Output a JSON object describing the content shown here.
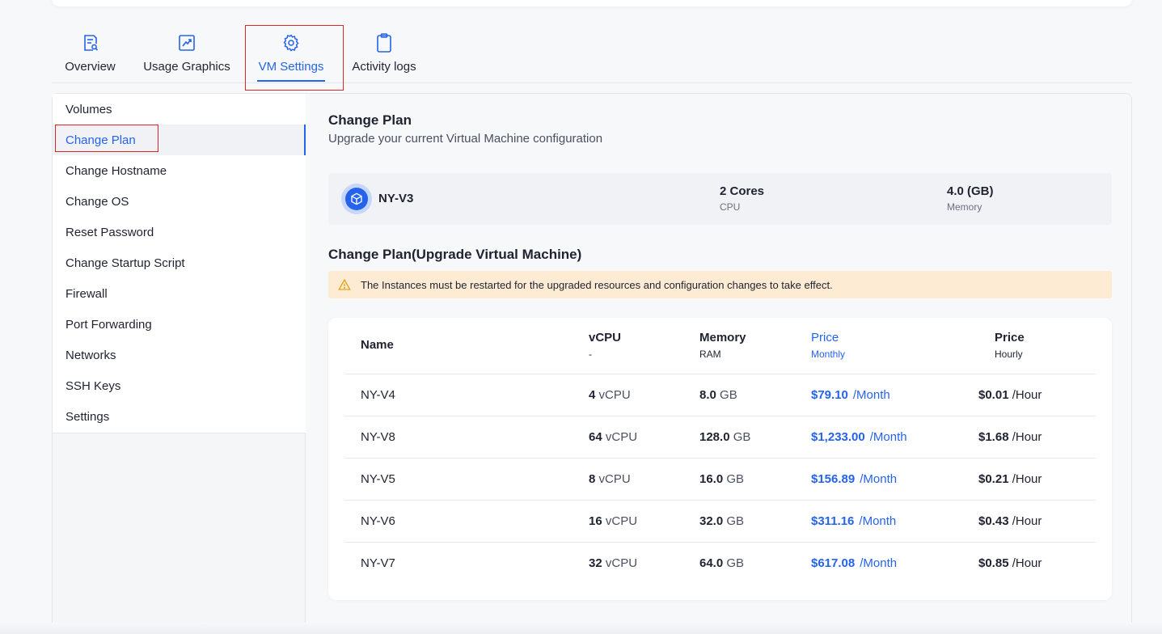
{
  "tabs": [
    {
      "label": "Overview",
      "icon": "document-search-icon"
    },
    {
      "label": "Usage Graphics",
      "icon": "line-chart-icon"
    },
    {
      "label": "VM Settings",
      "icon": "gear-icon",
      "active": true
    },
    {
      "label": "Activity logs",
      "icon": "clipboard-icon"
    }
  ],
  "sidebar": {
    "items": [
      {
        "label": "Volumes"
      },
      {
        "label": "Change Plan",
        "active": true
      },
      {
        "label": "Change Hostname"
      },
      {
        "label": "Change OS"
      },
      {
        "label": "Reset Password"
      },
      {
        "label": "Change Startup Script"
      },
      {
        "label": "Firewall"
      },
      {
        "label": "Port Forwarding"
      },
      {
        "label": "Networks"
      },
      {
        "label": "SSH Keys"
      },
      {
        "label": "Settings"
      }
    ]
  },
  "main": {
    "title": "Change Plan",
    "subtitle": "Upgrade your current Virtual Machine configuration",
    "current": {
      "name": "NY-V3",
      "cpu_value": "2 Cores",
      "cpu_label": "CPU",
      "memory_value": "4.0 (GB)",
      "memory_label": "Memory"
    },
    "section_title": "Change Plan(Upgrade Virtual Machine)",
    "alert": "The Instances must be restarted for the upgraded resources and configuration changes to take effect.",
    "table": {
      "headers": {
        "name": "Name",
        "vcpu": "vCPU",
        "vcpu_sub": "-",
        "memory": "Memory",
        "memory_sub": "RAM",
        "price_monthly": "Price",
        "price_monthly_sub": "Monthly",
        "price_hourly": "Price",
        "price_hourly_sub": "Hourly"
      },
      "units": {
        "vcpu": "vCPU",
        "memory": "GB",
        "month": "/Month",
        "hour": "/Hour"
      },
      "rows": [
        {
          "name": "NY-V4",
          "vcpu": "4",
          "memory": "8.0",
          "monthly": "$79.10",
          "hourly": "$0.01"
        },
        {
          "name": "NY-V8",
          "vcpu": "64",
          "memory": "128.0",
          "monthly": "$1,233.00",
          "hourly": "$1.68"
        },
        {
          "name": "NY-V5",
          "vcpu": "8",
          "memory": "16.0",
          "monthly": "$156.89",
          "hourly": "$0.21"
        },
        {
          "name": "NY-V6",
          "vcpu": "16",
          "memory": "32.0",
          "monthly": "$311.16",
          "hourly": "$0.43"
        },
        {
          "name": "NY-V7",
          "vcpu": "32",
          "memory": "64.0",
          "monthly": "$617.08",
          "hourly": "$0.85"
        }
      ]
    }
  },
  "colors": {
    "accent": "#2563eb",
    "highlight_border": "#e02424",
    "alert_bg": "#fdebd3"
  }
}
